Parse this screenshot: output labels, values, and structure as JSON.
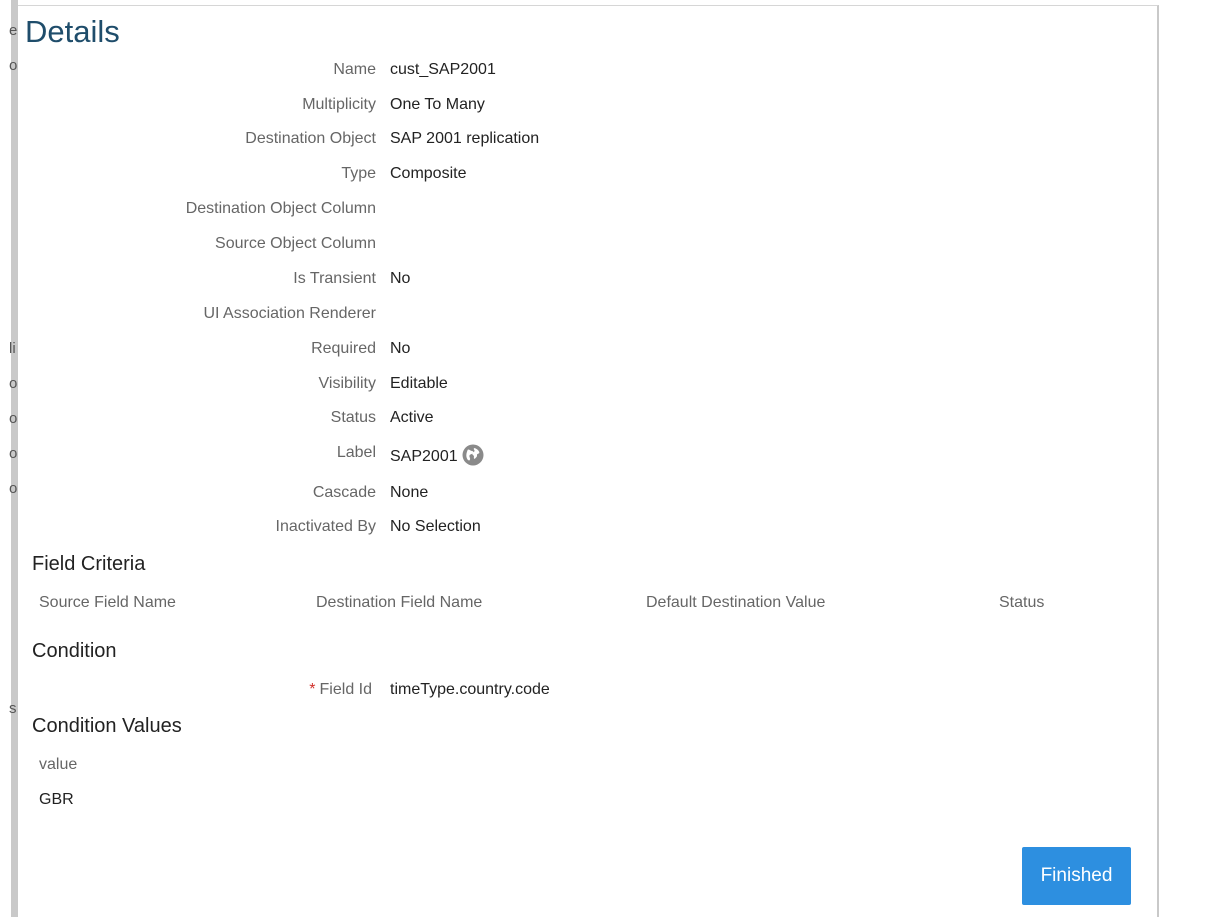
{
  "background": {
    "fragments": [
      "e",
      "o",
      "li",
      "o",
      "o",
      "o",
      "o",
      "s"
    ]
  },
  "dialog": {
    "title": "Details",
    "fields": [
      {
        "label": "Name",
        "value": "cust_SAP2001"
      },
      {
        "label": "Multiplicity",
        "value": "One To Many"
      },
      {
        "label": "Destination Object",
        "value": "SAP 2001 replication"
      },
      {
        "label": "Type",
        "value": "Composite"
      },
      {
        "label": "Destination Object Column",
        "value": ""
      },
      {
        "label": "Source Object Column",
        "value": ""
      },
      {
        "label": "Is Transient",
        "value": "No"
      },
      {
        "label": "UI Association Renderer",
        "value": ""
      },
      {
        "label": "Required",
        "value": "No"
      },
      {
        "label": "Visibility",
        "value": "Editable"
      },
      {
        "label": "Status",
        "value": "Active"
      },
      {
        "label": "Label",
        "value": "SAP2001",
        "icon": "globe-icon"
      },
      {
        "label": "Cascade",
        "value": "None"
      },
      {
        "label": "Inactivated By",
        "value": "No Selection"
      }
    ],
    "field_criteria": {
      "title": "Field Criteria",
      "columns": [
        "Source Field Name",
        "Destination Field Name",
        "Default Destination Value",
        "Status"
      ]
    },
    "condition": {
      "title": "Condition",
      "required_mark": "*",
      "field_label": "Field Id",
      "field_value": "timeType.country.code"
    },
    "condition_values": {
      "title": "Condition Values",
      "header": "value",
      "rows": [
        "GBR"
      ]
    },
    "finished_label": "Finished"
  },
  "colors": {
    "title": "#1f4d6b",
    "button": "#2d8fe0",
    "required": "#d0302a"
  }
}
